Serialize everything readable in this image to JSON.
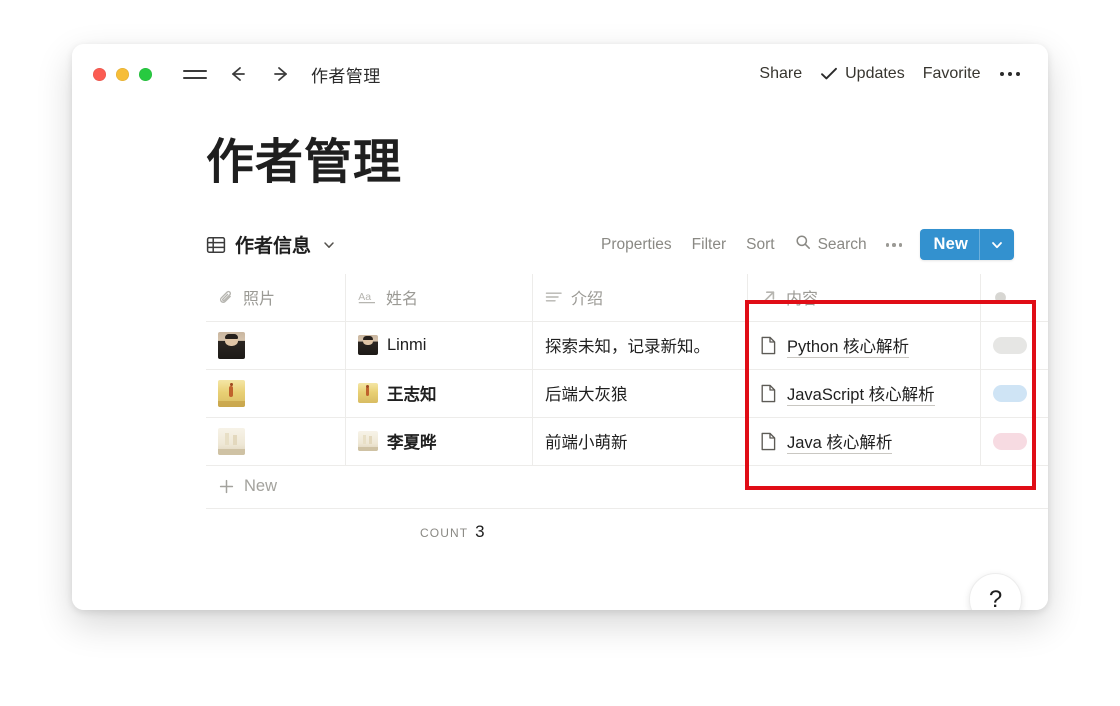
{
  "window": {
    "traffic_lights": [
      "close",
      "minimize",
      "maximize"
    ],
    "menu_icon": "hamburger-icon",
    "back_icon": "arrow-left-icon",
    "forward_icon": "arrow-right-icon",
    "doc_title": "作者管理"
  },
  "titlebar_actions": {
    "share": "Share",
    "updates": "Updates",
    "updates_icon": "check-icon",
    "favorite": "Favorite",
    "more_icon": "more-horizontal-icon"
  },
  "page": {
    "title": "作者管理"
  },
  "viewbar": {
    "view_icon": "table-grid-icon",
    "view_name": "作者信息",
    "view_chevron": "chevron-down-icon",
    "properties": "Properties",
    "filter": "Filter",
    "sort": "Sort",
    "search": "Search",
    "search_icon": "search-icon",
    "more_icon": "more-horizontal-icon",
    "new_label": "New",
    "new_chevron": "chevron-down-icon",
    "new_color": "#3391cf"
  },
  "table": {
    "columns": [
      {
        "label": "照片",
        "icon": "paperclip-icon",
        "type": "files"
      },
      {
        "label": "姓名",
        "icon": "aa-text-icon",
        "type": "title"
      },
      {
        "label": "介绍",
        "icon": "text-lines-icon",
        "type": "text"
      },
      {
        "label": "内容",
        "icon": "arrow-up-right-icon",
        "type": "relation"
      },
      {
        "label": "",
        "icon": "circle-icon",
        "type": "select"
      }
    ],
    "rows": [
      {
        "photo": "portrait-thumbnail",
        "photo_colors": [
          "#2f2a26",
          "#d9c7b4",
          "#1c1a18"
        ],
        "name": "Linmi",
        "name_bold": false,
        "intro": "探索未知，记录新知。",
        "content": "Python 核心解析",
        "content_icon": "page-icon",
        "tag_color": "#e6e6e4"
      },
      {
        "photo": "golden-landscape-thumbnail",
        "photo_colors": [
          "#e8d27a",
          "#f2e3a8",
          "#b8742e"
        ],
        "name": "王志知",
        "name_bold": true,
        "intro": "后端大灰狼",
        "content": "JavaScript 核心解析",
        "content_icon": "page-icon",
        "tag_color": "#cfe4f5"
      },
      {
        "photo": "pale-still-life-thumbnail",
        "photo_colors": [
          "#f0ebe0",
          "#e3dccb",
          "#c8bfa8"
        ],
        "name": "李夏晔",
        "name_bold": true,
        "intro": "前端小萌新",
        "content": "Java 核心解析",
        "content_icon": "page-icon",
        "tag_color": "#f7dbe2"
      }
    ],
    "new_row_label": "New",
    "new_row_icon": "plus-icon",
    "count_label": "COUNT",
    "count_value": "3"
  },
  "help": {
    "label": "?",
    "icon": "question-mark-icon"
  },
  "annotation": {
    "highlight_color": "#e00d16",
    "target_column": "内容"
  }
}
